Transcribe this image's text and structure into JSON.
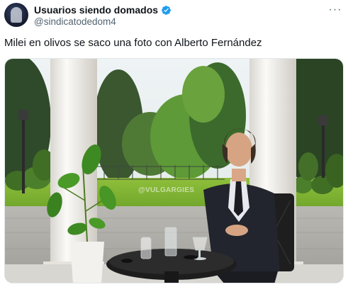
{
  "post": {
    "display_name": "Usuarios siendo domados",
    "handle": "@sindicatodedom4",
    "verified": true,
    "text": "Milei en olivos se saco una foto con Alberto Fernández"
  },
  "icons": {
    "verified": "verified-badge-icon",
    "more": "more-options-icon"
  },
  "media": {
    "watermark": "@VULGARGIES"
  },
  "colors": {
    "verified_blue": "#1d9bf0",
    "handle_gray": "#536471",
    "text": "#0f1419"
  }
}
